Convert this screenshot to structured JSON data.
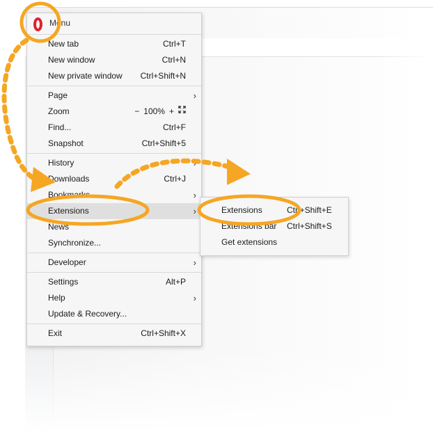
{
  "menu": {
    "title": "Menu",
    "groups": [
      [
        {
          "label": "New tab",
          "shortcut": "Ctrl+T"
        },
        {
          "label": "New window",
          "shortcut": "Ctrl+N"
        },
        {
          "label": "New private window",
          "shortcut": "Ctrl+Shift+N"
        }
      ],
      [
        {
          "label": "Page",
          "submenu": true
        },
        {
          "label": "Zoom",
          "zoom": {
            "minus": "−",
            "value": "100%",
            "plus": "+",
            "fullscreen_icon": "fullscreen-icon"
          }
        },
        {
          "label": "Find...",
          "shortcut": "Ctrl+F"
        },
        {
          "label": "Snapshot",
          "shortcut": "Ctrl+Shift+5"
        }
      ],
      [
        {
          "label": "History",
          "submenu": true
        },
        {
          "label": "Downloads",
          "shortcut": "Ctrl+J"
        },
        {
          "label": "Bookmarks",
          "submenu": true
        },
        {
          "label": "Extensions",
          "submenu": true,
          "highlighted": true
        },
        {
          "label": "News"
        },
        {
          "label": "Synchronize..."
        }
      ],
      [
        {
          "label": "Developer",
          "submenu": true
        }
      ],
      [
        {
          "label": "Settings",
          "shortcut": "Alt+P"
        },
        {
          "label": "Help",
          "submenu": true
        },
        {
          "label": "Update & Recovery..."
        }
      ],
      [
        {
          "label": "Exit",
          "shortcut": "Ctrl+Shift+X"
        }
      ]
    ]
  },
  "submenu": {
    "items": [
      {
        "label": "Extensions",
        "shortcut": "Ctrl+Shift+E"
      },
      {
        "label": "Extensions bar",
        "shortcut": "Ctrl+Shift+S"
      },
      {
        "label": "Get extensions"
      }
    ]
  },
  "colors": {
    "accent": "#f5a623",
    "opera_red": "#e0202c",
    "highlight": "#dfdfdf"
  }
}
